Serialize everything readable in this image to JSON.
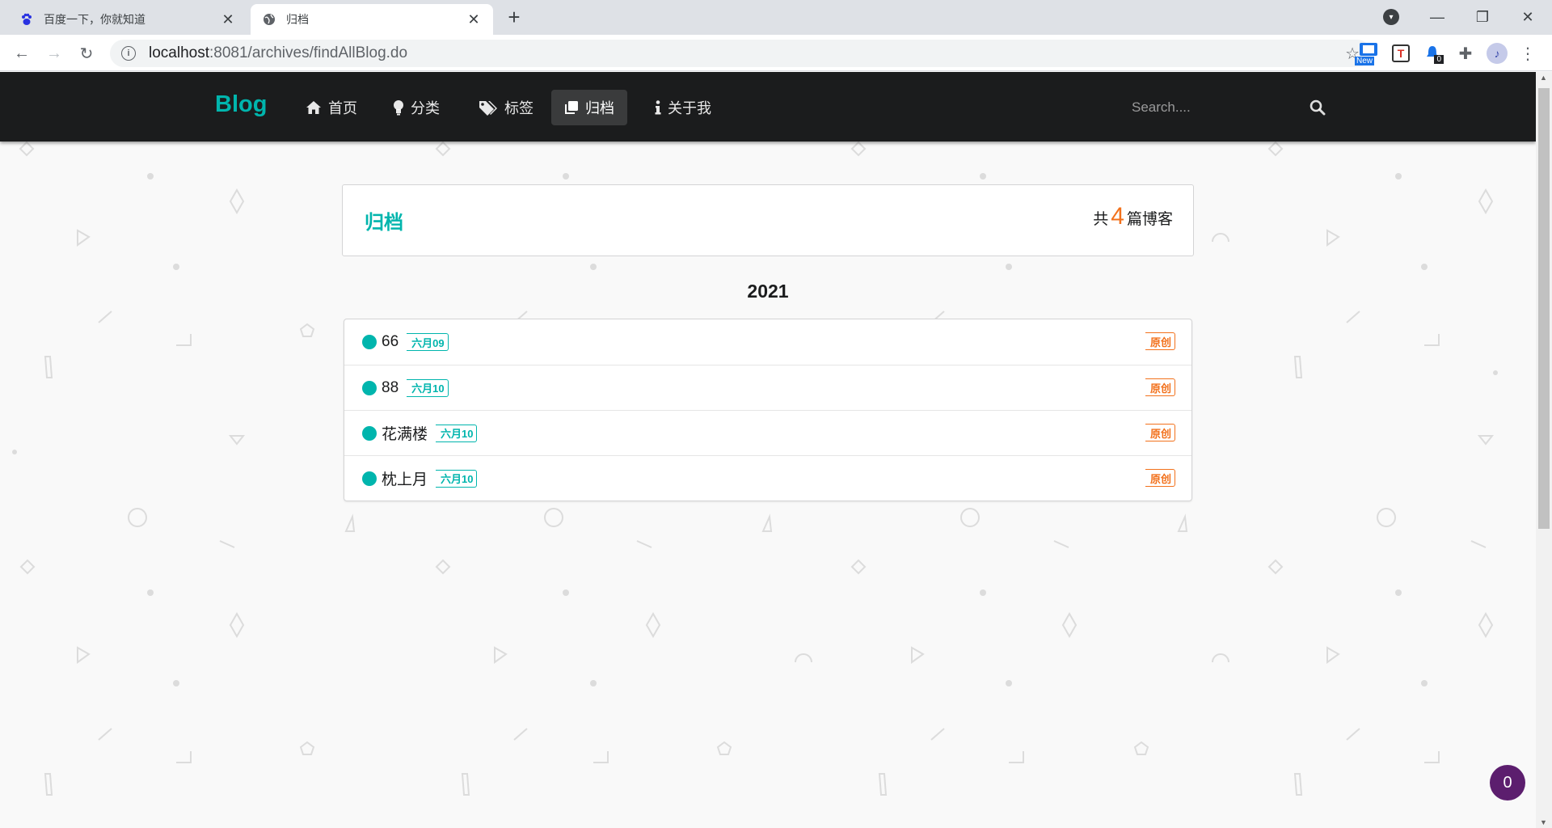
{
  "browser": {
    "tabs": [
      {
        "title": "百度一下，你就知道",
        "favicon": "baidu-paw-icon",
        "active": false
      },
      {
        "title": "归档",
        "favicon": "globe-icon",
        "active": true
      }
    ],
    "url_host": "localhost",
    "url_rest": ":8081/archives/findAllBlog.do",
    "extensions": {
      "new_badge": "New",
      "t_label": "T",
      "count_badge": "0"
    }
  },
  "navbar": {
    "brand": "Blog",
    "items": [
      {
        "label": "首页",
        "icon": "home-icon"
      },
      {
        "label": "分类",
        "icon": "lightbulb-icon"
      },
      {
        "label": "标签",
        "icon": "tags-icon"
      },
      {
        "label": "归档",
        "icon": "clone-icon",
        "active": true
      },
      {
        "label": "关于我",
        "icon": "info-icon"
      }
    ],
    "search_placeholder": "Search...."
  },
  "archive": {
    "title": "归档",
    "count_prefix": "共",
    "count": "4",
    "count_suffix": "篇博客",
    "year": "2021",
    "posts": [
      {
        "title": "66",
        "date": "六月09",
        "flag": "原创"
      },
      {
        "title": "88",
        "date": "六月10",
        "flag": "原创"
      },
      {
        "title": "花满楼",
        "date": "六月10",
        "flag": "原创"
      },
      {
        "title": "枕上月",
        "date": "六月10",
        "flag": "原创"
      }
    ]
  },
  "fab_count": "0",
  "colors": {
    "teal": "#00b5ad",
    "orange": "#f2711c",
    "navbar": "#1b1c1d",
    "fab": "#5c1e6e"
  }
}
